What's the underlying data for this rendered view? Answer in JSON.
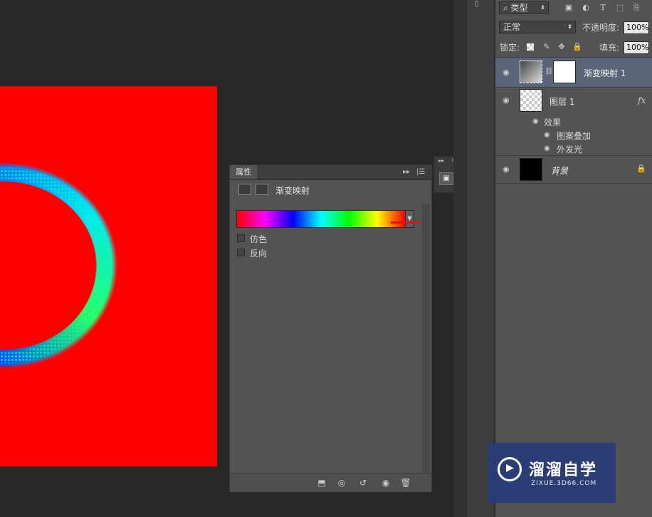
{
  "properties_panel": {
    "tab_title": "属性",
    "adjustment_name": "渐变映射",
    "gradient": {
      "colors": [
        "#ff0000",
        "#ff00ff",
        "#0000ff",
        "#00ffff",
        "#00ff00",
        "#ffff00",
        "#ff0000"
      ]
    },
    "options": [
      {
        "label": "仿色",
        "checked": false
      },
      {
        "label": "反向",
        "checked": false
      }
    ],
    "footer_icons": [
      "clip-to-layer-icon",
      "view-previous-state-icon",
      "reset-icon",
      "visibility-icon",
      "delete-icon"
    ]
  },
  "layers_panel": {
    "filter_kind": "类型",
    "blend_mode": "正常",
    "opacity_label": "不透明度:",
    "opacity_value": "100%",
    "lock_label": "锁定:",
    "fill_label": "填充:",
    "fill_value": "100%",
    "layers": [
      {
        "name": "渐变映射 1",
        "type": "adjustment",
        "selected": true
      },
      {
        "name": "图层 1",
        "type": "pixel",
        "fx": "fx",
        "effects_label": "效果",
        "effects": [
          "图案叠加",
          "外发光"
        ]
      },
      {
        "name": "背景",
        "type": "background",
        "locked": true
      }
    ]
  },
  "canvas": {
    "background_color": "#ff0000"
  },
  "watermark": {
    "title": "溜溜自学",
    "url": "ZIXUE.3D66.COM"
  }
}
